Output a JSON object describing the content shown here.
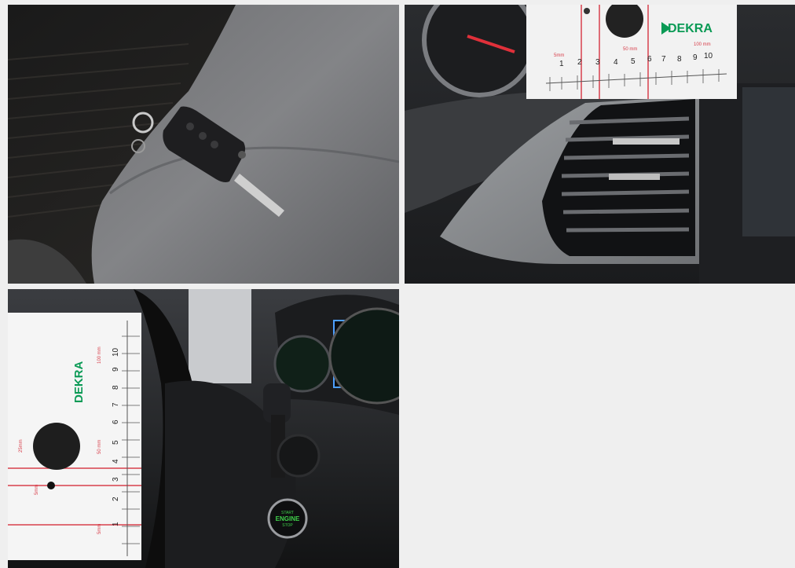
{
  "gallery": {
    "photos": [
      {
        "subject": "car-key-on-seat"
      },
      {
        "subject": "dashboard-air-vent-with-ruler",
        "ruler": {
          "brand": "DEKRA",
          "scale": [
            "1",
            "2",
            "3",
            "4",
            "5",
            "6",
            "7",
            "8",
            "9",
            "10"
          ],
          "mark_5mm": "5mm",
          "mark_50mm": "50 mm",
          "mark_100mm": "100 mm"
        }
      },
      {
        "subject": "ignition-steering-column-with-ruler",
        "ruler": {
          "brand": "DEKRA",
          "scale": [
            "1",
            "2",
            "3",
            "4",
            "5",
            "6",
            "7",
            "8",
            "9",
            "10"
          ],
          "mark_5mm": "5mm",
          "mark_50mm": "50 mm",
          "mark_100mm": "100 mm",
          "mark_25mm": "25mm"
        },
        "button": {
          "line1": "START",
          "line2": "ENGINE",
          "line3": "STOP"
        }
      }
    ]
  },
  "colors": {
    "dekra_green": "#0a9a55",
    "ruler_red": "#d8404c",
    "engine_button_green": "#3fd14a"
  }
}
